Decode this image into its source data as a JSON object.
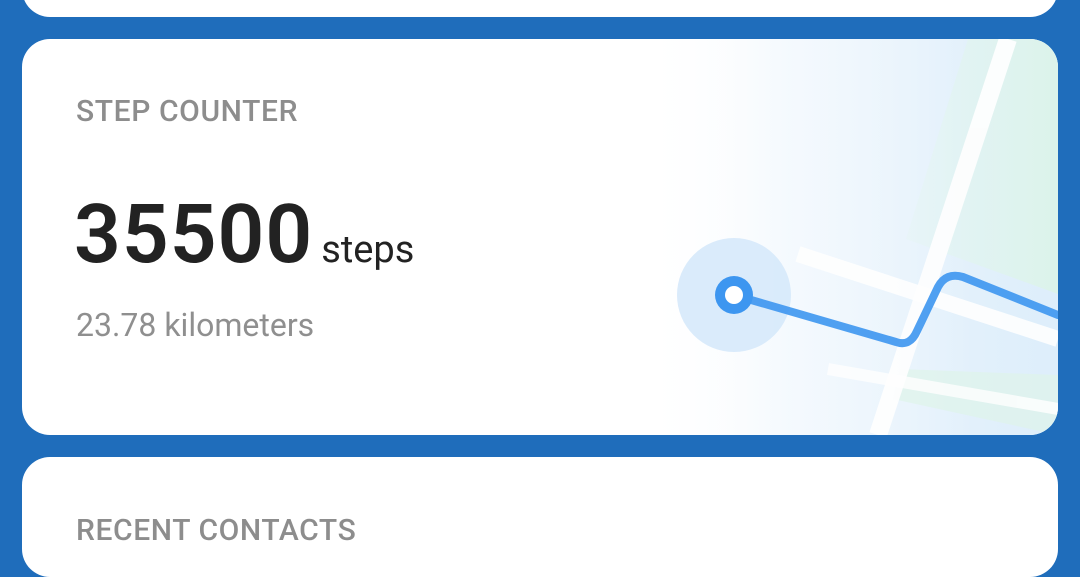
{
  "step_counter": {
    "title": "STEP COUNTER",
    "steps_value": "35500",
    "steps_unit": "steps",
    "distance": "23.78 kilometers"
  },
  "next_card": {
    "title": "RECENT CONTACTS"
  },
  "icons": {
    "route": "route-map-icon"
  },
  "colors": {
    "background": "#1f6dbb",
    "card": "#ffffff",
    "accent": "#3d96f0",
    "label": "#8d8d8d",
    "value": "#222222"
  }
}
